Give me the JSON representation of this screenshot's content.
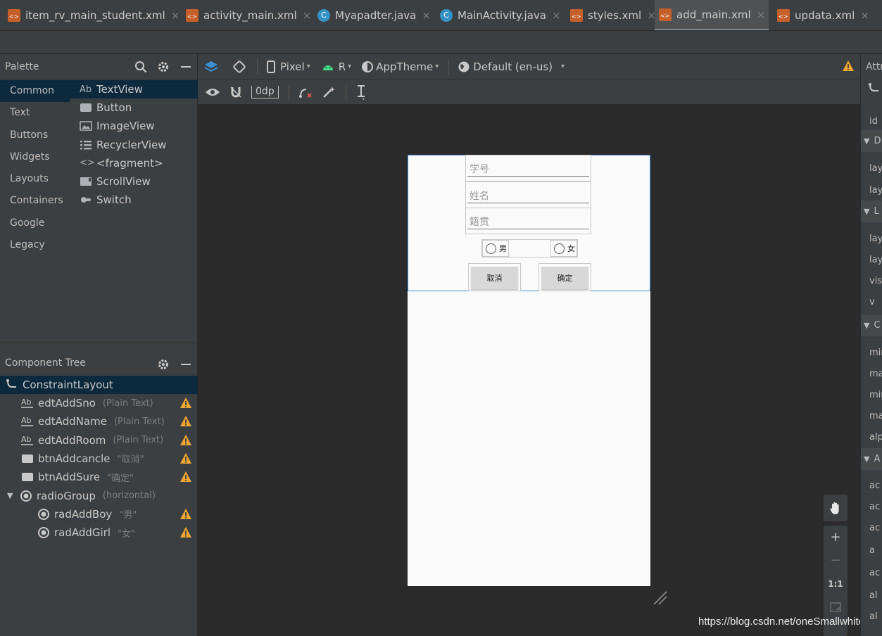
{
  "tabs": [
    {
      "name": "item_rv_main_student.xml",
      "type": "xml",
      "active": false
    },
    {
      "name": "activity_main.xml",
      "type": "xml",
      "active": false
    },
    {
      "name": "Myapadter.java",
      "type": "java",
      "active": false
    },
    {
      "name": "MainActivity.java",
      "type": "java",
      "active": false
    },
    {
      "name": "styles.xml",
      "type": "xml",
      "active": false
    },
    {
      "name": "add_main.xml",
      "type": "xml",
      "active": true
    },
    {
      "name": "updata.xml",
      "type": "xml",
      "active": false
    }
  ],
  "tab_close_glyph": "×",
  "java_badge": "C",
  "palette": {
    "title": "Palette",
    "categories": [
      "Common",
      "Text",
      "Buttons",
      "Widgets",
      "Layouts",
      "Containers",
      "Google",
      "Legacy"
    ],
    "selected_category": "Common",
    "widgets": [
      {
        "label": "TextView",
        "icon": "Ab"
      },
      {
        "label": "Button",
        "icon": "button-icon"
      },
      {
        "label": "ImageView",
        "icon": "image-icon"
      },
      {
        "label": "RecyclerView",
        "icon": "list-icon"
      },
      {
        "label": "<fragment>",
        "icon": "<>"
      },
      {
        "label": "ScrollView",
        "icon": "scroll-icon"
      },
      {
        "label": "Switch",
        "icon": "switch-icon"
      }
    ]
  },
  "toolbar": {
    "device": "Pixel",
    "api": "R",
    "theme": "AppTheme",
    "locale": "Default (en-us)",
    "margin": "0dp"
  },
  "component_tree": {
    "title": "Component Tree",
    "root": "ConstraintLayout",
    "items": [
      {
        "id": "edtAddSno",
        "hint": "(Plain Text)",
        "icon": "Ab",
        "level": 1,
        "warning": true
      },
      {
        "id": "edtAddName",
        "hint": "(Plain Text)",
        "icon": "Ab",
        "level": 1,
        "warning": true
      },
      {
        "id": "edtAddRoom",
        "hint": "(Plain Text)",
        "icon": "Ab",
        "level": 1,
        "warning": true
      },
      {
        "id": "btnAddcancle",
        "hint": "\"取消\"",
        "icon": "button",
        "level": 1,
        "warning": true
      },
      {
        "id": "btnAddSure",
        "hint": "\"确定\"",
        "icon": "button",
        "level": 1,
        "warning": true
      },
      {
        "id": "radioGroup",
        "hint": "(horizontal)",
        "icon": "radio",
        "level": 1,
        "warning": false,
        "expanded": true
      },
      {
        "id": "radAddBoy",
        "hint": "\"男\"",
        "icon": "radio",
        "level": 2,
        "warning": true
      },
      {
        "id": "radAddGirl",
        "hint": "\"女\"",
        "icon": "radio",
        "level": 2,
        "warning": true
      }
    ]
  },
  "preview": {
    "fields": [
      "学号",
      "姓名",
      "籍贯"
    ],
    "radio_boy": "男",
    "radio_girl": "女",
    "cancel": "取消",
    "confirm": "确定"
  },
  "zoom": {
    "one_to_one": "1:1"
  },
  "attributes": {
    "title": "Attr",
    "rows": [
      "id",
      "lay",
      "lay",
      "lay",
      "lay",
      "visi",
      "v",
      "mir",
      "ma",
      "mir",
      "ma",
      "alp",
      "ac",
      "ac",
      "ac",
      "a",
      "ac",
      "al",
      "al"
    ],
    "sections": [
      "D",
      "L",
      "C",
      "A"
    ]
  },
  "watermark": "https://blog.csdn.net/oneSmallwhite",
  "colors": {
    "warning": "#f0a732",
    "selection": "#0d293e",
    "accent": "#4a90d9"
  }
}
